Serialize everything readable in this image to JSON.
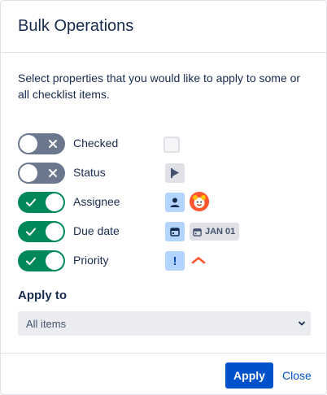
{
  "dialog": {
    "title": "Bulk Operations",
    "description": "Select properties that you would like to apply to some or all checklist items."
  },
  "properties": [
    {
      "label": "Checked",
      "enabled": false
    },
    {
      "label": "Status",
      "enabled": false
    },
    {
      "label": "Assignee",
      "enabled": true
    },
    {
      "label": "Due date",
      "enabled": true,
      "date": "JAN 01"
    },
    {
      "label": "Priority",
      "enabled": true,
      "priority_symbol": "!"
    }
  ],
  "apply_to": {
    "label": "Apply to",
    "selected": "All items"
  },
  "footer": {
    "apply_label": "Apply",
    "close_label": "Close"
  },
  "colors": {
    "toggle_on": "#00875a",
    "toggle_off": "#6b778c",
    "primary": "#0052cc",
    "priority_high": "#ff5630"
  },
  "icons": {
    "status": "flag-icon",
    "assignee": "person-icon",
    "due_date": "calendar-icon",
    "avatar": "user-avatar"
  }
}
